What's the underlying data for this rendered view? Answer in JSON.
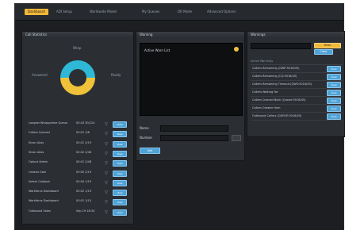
{
  "tabs": [
    {
      "label": "Dashboard",
      "active": true
    },
    {
      "label": "ADI Setup"
    },
    {
      "label": "Worldwide Model"
    },
    {
      "label": "My Queues"
    },
    {
      "label": "DR Mode"
    },
    {
      "label": "Advanced Options"
    }
  ],
  "left_panel": {
    "title": "Call Statistics",
    "donut": {
      "top_label": "Wrap",
      "left_label": "Answered",
      "right_label": "Ready",
      "colors": [
        "#f0c23a",
        "#2eb8d6"
      ],
      "shares": [
        0.5,
        0.5
      ]
    },
    "rows": [
      {
        "label": "Longest Wrapuptime Queue",
        "value": "00:43 30/124",
        "button": "View"
      },
      {
        "label": "Callers Queued",
        "value": "00:01 1/8",
        "button": "View"
      },
      {
        "label": "Sinan Alias",
        "value": "00:01 2/19",
        "button": "View"
      },
      {
        "label": "Sinan Alias",
        "value": "00:02 2/48",
        "button": "View"
      },
      {
        "label": "Optout Admin",
        "value": "00:01 2/48",
        "button": "View"
      },
      {
        "label": "Octavio Sale",
        "value": "00:00 2/19",
        "button": "View"
      },
      {
        "label": "Admin Callback",
        "value": "00:00 1/19",
        "button": "View"
      },
      {
        "label": "Workforce Dashboard",
        "value": "00:02 1/19",
        "button": "View"
      },
      {
        "label": "Workforce Dashboard",
        "value": "00:01 1/10",
        "button": "View"
      },
      {
        "label": "Outbound Sales",
        "value": "Sep 19 18:34",
        "button": "View"
      }
    ]
  },
  "middle_panel": {
    "title": "Warning",
    "box_text": "Active Warn List",
    "fields": [
      {
        "label": "Name"
      },
      {
        "label": "Number"
      }
    ],
    "add_button": "Add"
  },
  "right_panel": {
    "title": "Warnings",
    "search_placeholder": "",
    "orange_button": "Filter",
    "blue_button": "Clear",
    "list_header": "Active Warnings",
    "items": [
      {
        "text": "Callers Remaining (GWP:5016/45)",
        "button": "View"
      },
      {
        "text": "Callers Remaining (CQ:5016/45)",
        "button": "View"
      },
      {
        "text": "Callers Remaining Timeout (QWS:5016/45)",
        "button": "View"
      },
      {
        "text": "Callers Waiting Far",
        "button": "View"
      },
      {
        "text": "Callers Queued Back (Queue:5016/45)",
        "button": "View"
      },
      {
        "text": "Callers Greater then",
        "button": "View"
      },
      {
        "text": "Outbound Callers (QUEUE:5016/45)",
        "button": "View"
      }
    ]
  }
}
